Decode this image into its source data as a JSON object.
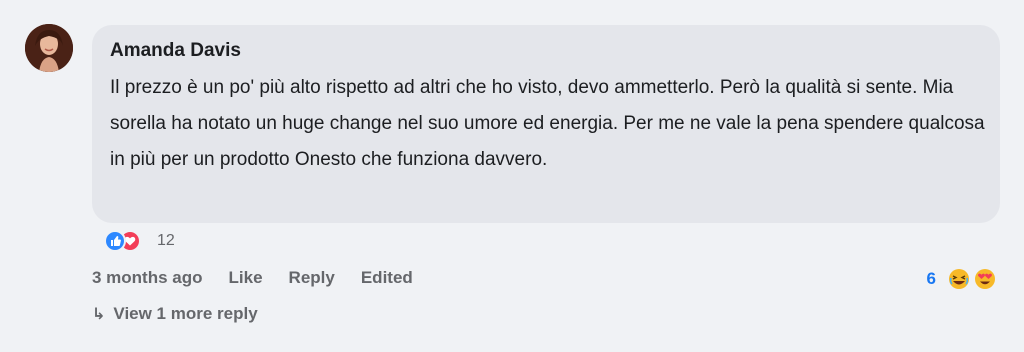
{
  "comment": {
    "author": "Amanda Davis",
    "text": "Il prezzo è un po' più alto rispetto ad altri che ho visto, devo ammetterlo. Però la qualità si sente. Mia sorella ha notato un huge change nel suo umore ed energia. Per me ne vale la pena spendere qualcosa in più per un prodotto Onesto che funziona davvero."
  },
  "reactions": {
    "count": "12",
    "icons": [
      "like-icon",
      "love-icon"
    ],
    "colors": {
      "like": "#2d88ff",
      "love": "#f33e58"
    }
  },
  "actions": {
    "timestamp": "3 months ago",
    "like": "Like",
    "reply": "Reply",
    "edited": "Edited"
  },
  "reply_reactions": {
    "count": "6",
    "icons": [
      "laughing-emoji-icon",
      "heart-eyes-emoji-icon"
    ]
  },
  "replies": {
    "arrow": "↳",
    "view_more": "View 1 more reply"
  }
}
